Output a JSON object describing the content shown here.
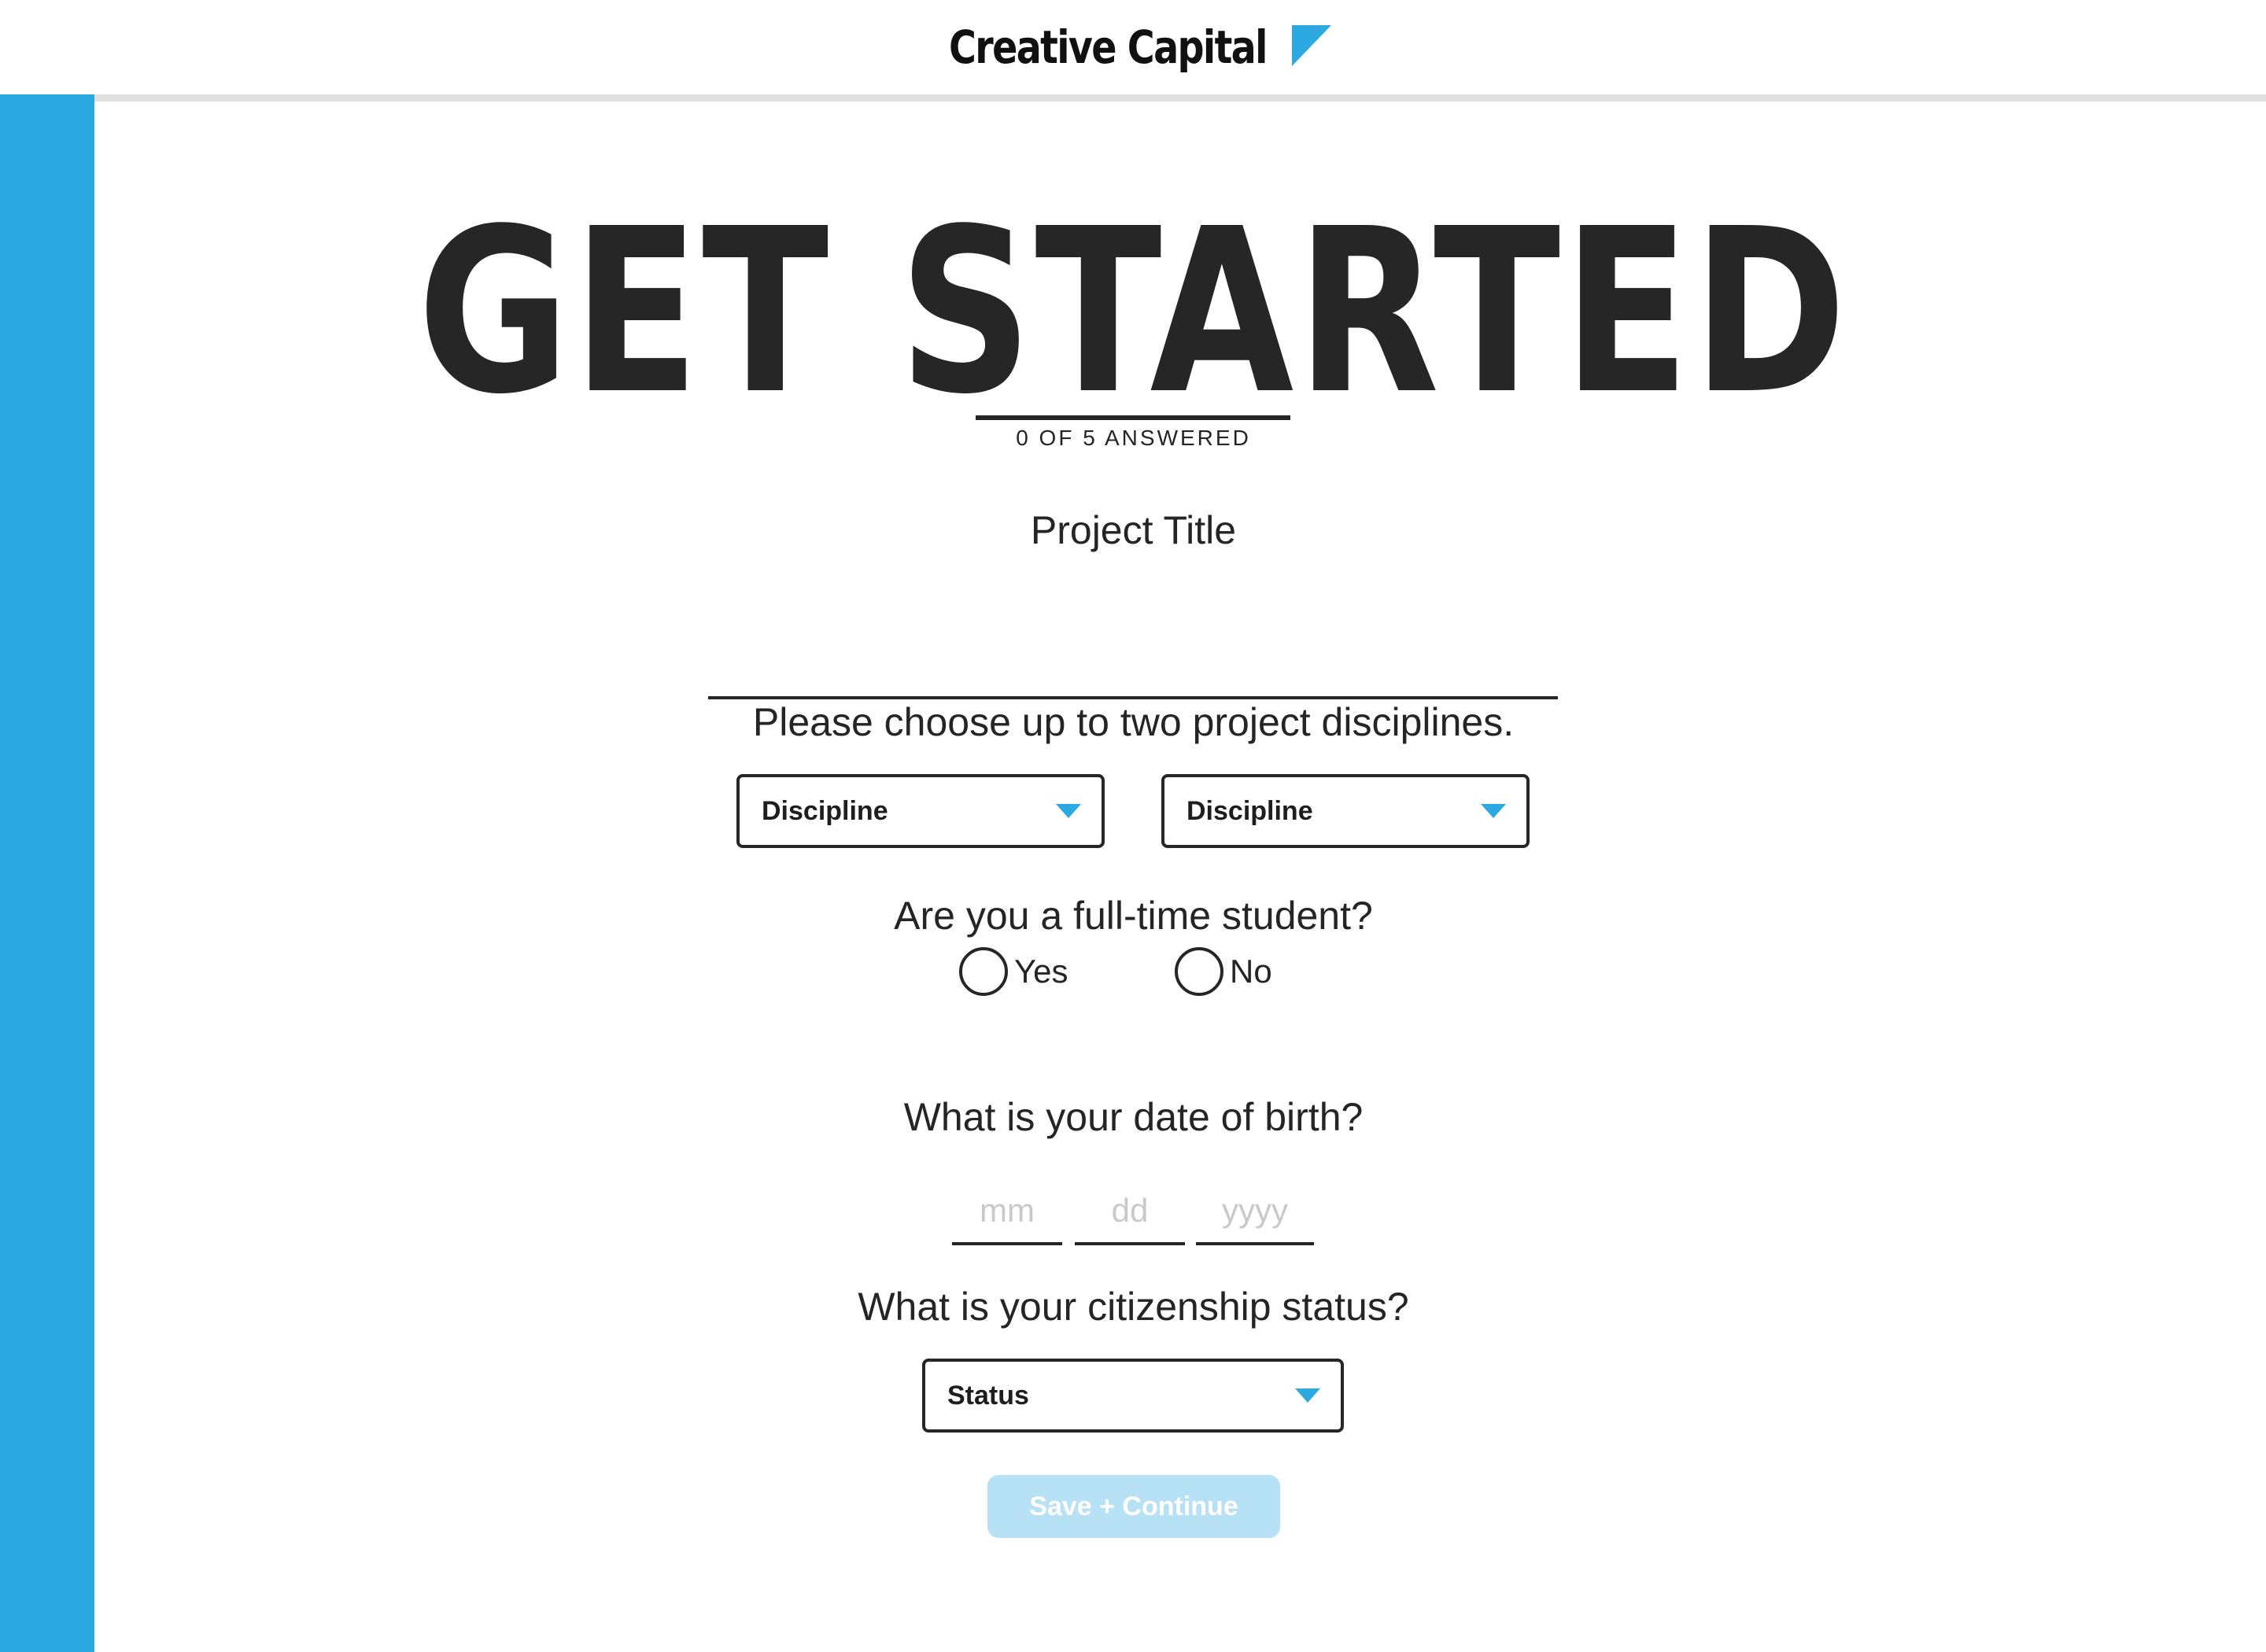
{
  "header": {
    "brand_name": "Creative Capital",
    "brand_color": "#2da9e1"
  },
  "accent_color": "#2da9e1",
  "page": {
    "title": "GET STARTED",
    "progress_text": "0 OF 5 ANSWERED",
    "progress_answered": 0,
    "progress_total": 5
  },
  "questions": {
    "project_title": {
      "label": "Project Title",
      "value": ""
    },
    "disciplines": {
      "label": "Please choose up to two project disciplines.",
      "select_1": "Discipline",
      "select_2": "Discipline",
      "caret_icon": "caret-down-icon"
    },
    "student": {
      "label": "Are you a full-time student?",
      "options": [
        "Yes",
        "No"
      ],
      "selected": null
    },
    "dob": {
      "label": "What is your date of birth?",
      "month_placeholder": "mm",
      "day_placeholder": "dd",
      "year_placeholder": "yyyy"
    },
    "citizenship": {
      "label": "What is your citizenship status?",
      "select": "Status"
    }
  },
  "actions": {
    "submit_label": "Save + Continue",
    "submit_enabled": false,
    "submit_color": "#b7e1f5"
  }
}
